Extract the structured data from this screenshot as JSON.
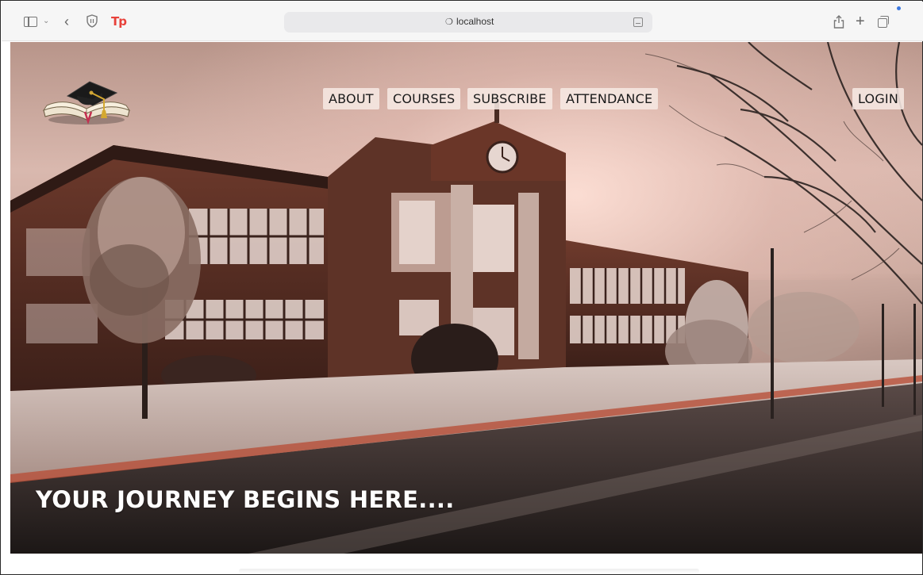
{
  "browser": {
    "address": "localhost",
    "icons": [
      "sidebar-icon",
      "chevron-down-icon",
      "back-icon",
      "shield-icon",
      "tp-extension-icon",
      "lock-icon",
      "reader-icon",
      "share-icon",
      "plus-icon",
      "tabs-icon"
    ],
    "extension_label": "Tp"
  },
  "site": {
    "nav": {
      "about": "ABOUT",
      "courses": "COURSES",
      "subscribe": "SUBSCRIBE",
      "attendance": "ATTENDANCE",
      "login": "LOGIN"
    },
    "hero": {
      "headline": "YOUR JOURNEY BEGINS HERE...."
    },
    "logo": "graduation-cap-book-icon"
  },
  "colors": {
    "nav_bg": "#f6e8e2",
    "extension_red": "#e8413a",
    "headline": "#ffffff",
    "brick": "#6b3426"
  }
}
